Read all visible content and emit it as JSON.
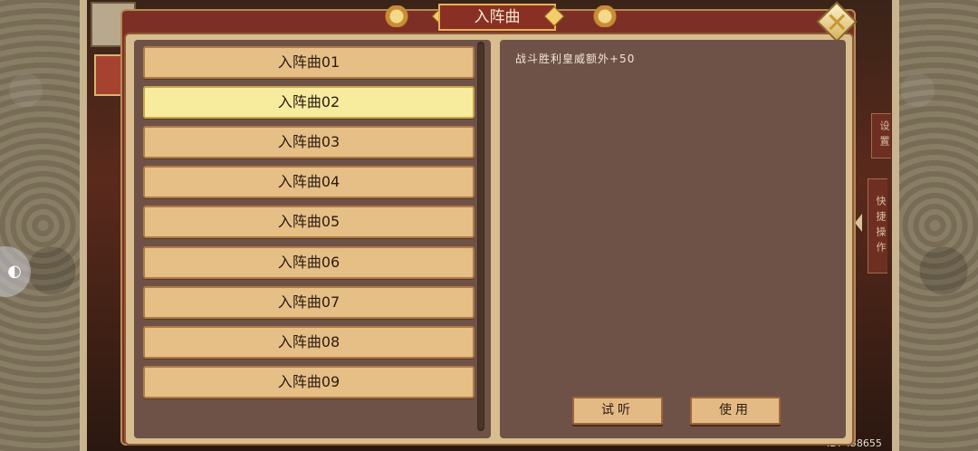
{
  "dialog": {
    "title": "入阵曲",
    "items": [
      {
        "label": "入阵曲01",
        "selected": false
      },
      {
        "label": "入阵曲02",
        "selected": true
      },
      {
        "label": "入阵曲03",
        "selected": false
      },
      {
        "label": "入阵曲04",
        "selected": false
      },
      {
        "label": "入阵曲05",
        "selected": false
      },
      {
        "label": "入阵曲06",
        "selected": false
      },
      {
        "label": "入阵曲07",
        "selected": false
      },
      {
        "label": "入阵曲08",
        "selected": false
      },
      {
        "label": "入阵曲09",
        "selected": false
      }
    ],
    "description": "战斗胜利皇威额外+50",
    "buttons": {
      "listen": "试听",
      "use": "使用"
    }
  },
  "side": {
    "settings": "设置",
    "shortcut": "快捷操作"
  },
  "player_id": "ID: 458655",
  "colors": {
    "frame_red": "#7d2f25",
    "panel_brown": "#6e5248",
    "item_tan": "#e6bf86",
    "item_selected": "#f7ec9e",
    "gold": "#e2b457"
  }
}
